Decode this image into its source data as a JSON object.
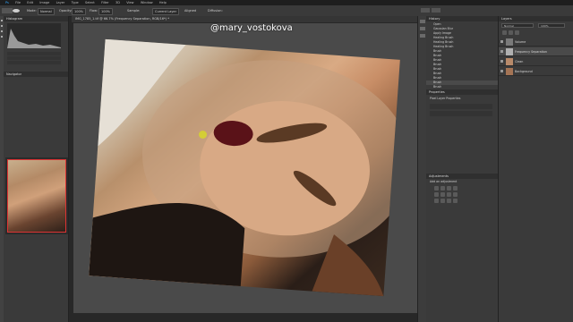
{
  "menu": [
    "Ps",
    "File",
    "Edit",
    "Image",
    "Layer",
    "Type",
    "Select",
    "Filter",
    "3D",
    "View",
    "Window",
    "Help"
  ],
  "options": {
    "mode": "Normal",
    "opacity_label": "Opacity:",
    "opacity": "100%",
    "flow_label": "Flow:",
    "flow": "100%",
    "sample": "Current Layer",
    "aligned": "Aligned",
    "diffusion": "Diffusion:"
  },
  "document": {
    "tab_title": "IMG_1785_1.tif @ 66.7% (Frequency Separation, RGB/16*) *",
    "watermark": "@mary_vostokova"
  },
  "left_panel": {
    "histogram_title": "Histogram",
    "navigator_title": "Navigator"
  },
  "mid_panel": {
    "history_title": "History",
    "history_items": [
      "Open",
      "Gaussian Blur",
      "Apply Image",
      "Healing Brush",
      "Healing Brush",
      "Healing Brush",
      "Brush",
      "Brush",
      "Brush",
      "Brush",
      "Brush",
      "Brush",
      "Brush",
      "Brush",
      "Brush"
    ],
    "properties_title": "Properties",
    "properties_subtitle": "Pixel Layer Properties",
    "adjustments_title": "Adjustments",
    "adjustments_subtitle": "Add an adjustment"
  },
  "right_panel": {
    "layers_title": "Layers",
    "blend_mode": "Normal",
    "opacity": "100%",
    "layers": [
      {
        "name": "Volume",
        "active": false,
        "thumb": "#7a7a7a"
      },
      {
        "name": "Frequency Separation",
        "active": true,
        "thumb": "#b0b0b0"
      },
      {
        "name": "Clean",
        "active": false,
        "thumb": "#b88a6a"
      },
      {
        "name": "Background",
        "active": false,
        "thumb": "#a47455"
      }
    ]
  },
  "colors": {
    "accent": "#2d8ceb",
    "brush_cursor": "#d6d62a"
  }
}
